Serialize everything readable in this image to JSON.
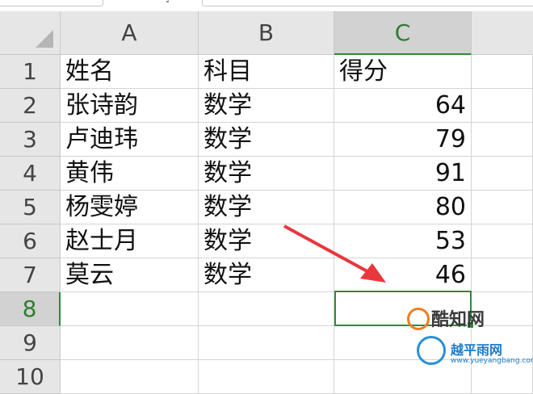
{
  "columns": [
    "A",
    "B",
    "C"
  ],
  "rows": [
    "1",
    "2",
    "3",
    "4",
    "5",
    "6",
    "7",
    "8",
    "9",
    "10"
  ],
  "table": [
    [
      "姓名",
      "科目",
      "得分"
    ],
    [
      "张诗韵",
      "数学",
      "64"
    ],
    [
      "卢迪玮",
      "数学",
      "79"
    ],
    [
      "黄伟",
      "数学",
      "91"
    ],
    [
      "杨雯婷",
      "数学",
      "80"
    ],
    [
      "赵士月",
      "数学",
      "53"
    ],
    [
      "莫云",
      "数学",
      "46"
    ]
  ],
  "selection": {
    "column": "C",
    "row": "8"
  },
  "colors": {
    "accent": "#2f8a3a",
    "arrow": "#e8383d",
    "header_bg": "#e6e6e6"
  },
  "watermarks": {
    "logo1": "酷知网",
    "logo2": "越平雨网",
    "logo2_url": "www.yueyangbang.com"
  }
}
